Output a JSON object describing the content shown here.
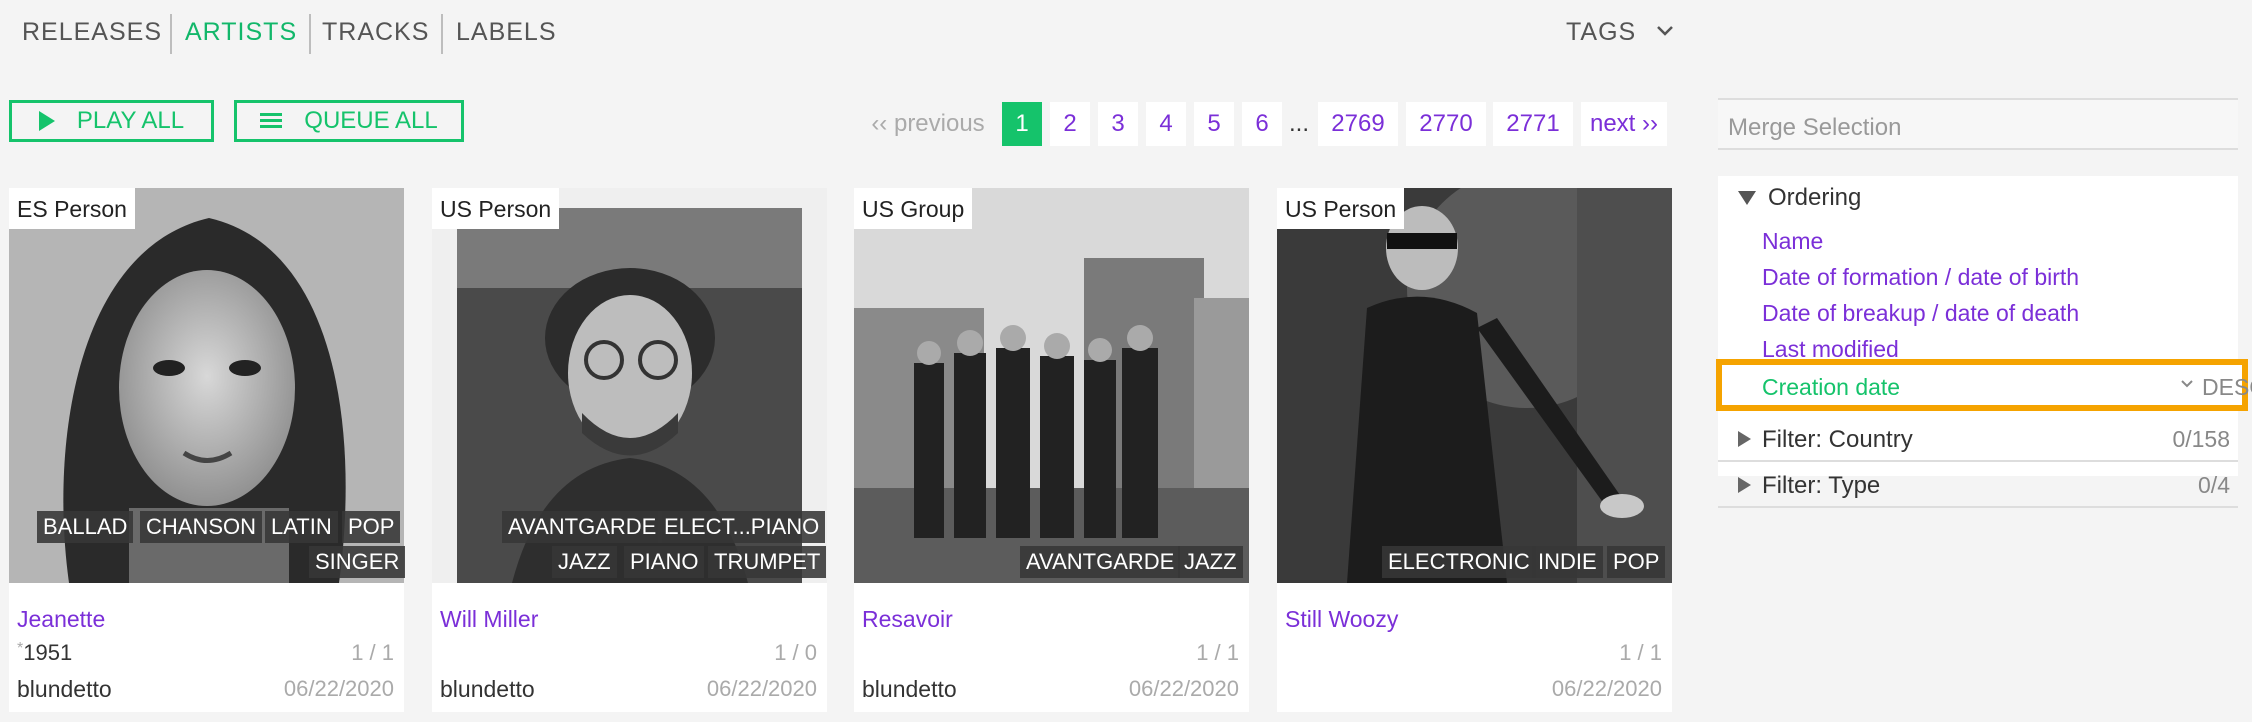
{
  "nav": {
    "items": [
      {
        "label": "RELEASES",
        "active": false
      },
      {
        "label": "ARTISTS",
        "active": true
      },
      {
        "label": "TRACKS",
        "active": false
      },
      {
        "label": "LABELS",
        "active": false
      }
    ],
    "tags": "TAGS"
  },
  "actions": {
    "play_all": "PLAY ALL",
    "queue_all": "QUEUE ALL"
  },
  "pager": {
    "previous": "‹‹ previous",
    "pages": [
      "1",
      "2",
      "3",
      "4",
      "5",
      "6"
    ],
    "dots": "...",
    "tail": [
      "2769",
      "2770",
      "2771"
    ],
    "next": "next ››",
    "current": "1"
  },
  "cards": [
    {
      "badge": "ES Person",
      "tags": [
        "BALLAD",
        "CHANSON",
        "LATIN",
        "POP",
        "SINGER"
      ],
      "name": "Jeanette",
      "ratio": "1 / 1",
      "born": "1951",
      "user": "blundetto",
      "date": "06/22/2020"
    },
    {
      "badge": "US Person",
      "tags": [
        "AVANTGARDE",
        "ELECT...PIANO",
        "JAZZ",
        "PIANO",
        "TRUMPET"
      ],
      "name": "Will Miller",
      "ratio": "1 / 0",
      "born": "",
      "user": "blundetto",
      "date": "06/22/2020"
    },
    {
      "badge": "US Group",
      "tags": [
        "AVANTGARDE",
        "JAZZ"
      ],
      "name": "Resavoir",
      "ratio": "1 / 1",
      "born": "",
      "user": "blundetto",
      "date": "06/22/2020"
    },
    {
      "badge": "US Person",
      "tags": [
        "ELECTRONIC",
        "INDIE",
        "POP"
      ],
      "name": "Still Woozy",
      "ratio": "1 / 1",
      "born": "",
      "user": "",
      "date": "06/22/2020"
    }
  ],
  "sidebar": {
    "merge": "Merge Selection",
    "ordering": {
      "title": "Ordering",
      "options": [
        "Name",
        "Date of formation / date of birth",
        "Date of breakup / date of death",
        "Last modified",
        "Creation date"
      ],
      "selected": "Creation date",
      "direction": "DESC"
    },
    "filters": [
      {
        "label": "Filter: Country",
        "count": "0/158"
      },
      {
        "label": "Filter: Type",
        "count": "0/4"
      }
    ]
  },
  "colors": {
    "accent": "#15c36b",
    "link": "#7b2fd8",
    "highlight": "#f5a300"
  }
}
